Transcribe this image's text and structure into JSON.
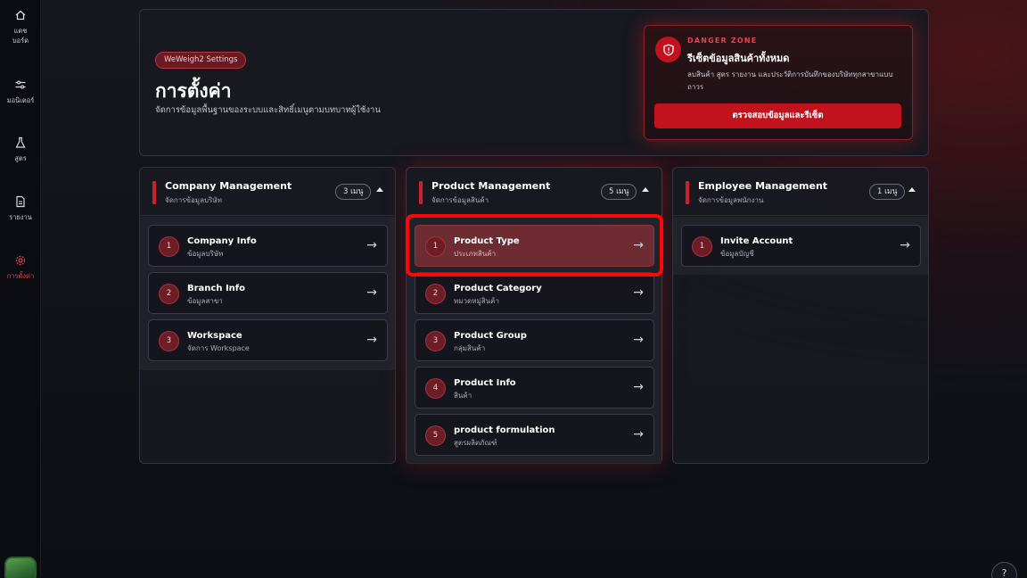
{
  "sidebar": {
    "items": [
      {
        "label": "แดช\nบอร์ด",
        "icon": "home-icon",
        "active": false
      },
      {
        "label": "มอนิเตอร์",
        "icon": "monitor-icon",
        "active": false
      },
      {
        "label": "สูตร",
        "icon": "flask-icon",
        "active": false
      },
      {
        "label": "รายงาน",
        "icon": "document-icon",
        "active": false
      },
      {
        "label": "การตั้งค่า",
        "icon": "gear-icon",
        "active": true
      }
    ]
  },
  "header": {
    "badge": "WeWeigh2 Settings",
    "title": "การตั้งค่า",
    "subtitle": "จัดการข้อมูลพื้นฐานของระบบและสิทธิ์เมนูตามบทบาทผู้ใช้งาน"
  },
  "danger_zone": {
    "label": "DANGER ZONE",
    "title": "รีเซ็ตข้อมูลสินค้าทั้งหมด",
    "description": "ลบสินค้า สูตร รายงาน และประวัติการบันทึกของบริษัททุกสาขาแบบถาวร",
    "button": "ตรวจสอบข้อมูลและรีเซ็ต",
    "accent_color": "#c1121e"
  },
  "columns": [
    {
      "title": "Company Management",
      "subtitle": "จัดการข้อมูลบริษัท",
      "count": "3 เมนู",
      "items": [
        {
          "num": "1",
          "title": "Company Info",
          "subtitle": "ข้อมูลบริษัท"
        },
        {
          "num": "2",
          "title": "Branch Info",
          "subtitle": "ข้อมูลสาขา"
        },
        {
          "num": "3",
          "title": "Workspace",
          "subtitle": "จัดการ Workspace"
        }
      ]
    },
    {
      "title": "Product Management",
      "subtitle": "จัดการข้อมูลสินค้า",
      "count": "5 เมนู",
      "items": [
        {
          "num": "1",
          "title": "Product Type",
          "subtitle": "ประเภทสินค้า"
        },
        {
          "num": "2",
          "title": "Product Category",
          "subtitle": "หมวดหมู่สินค้า"
        },
        {
          "num": "3",
          "title": "Product Group",
          "subtitle": "กลุ่มสินค้า"
        },
        {
          "num": "4",
          "title": "Product Info",
          "subtitle": "สินค้า"
        },
        {
          "num": "5",
          "title": "product formulation",
          "subtitle": "สูตรผลิตภัณฑ์"
        }
      ]
    },
    {
      "title": "Employee Management",
      "subtitle": "จัดการข้อมูลพนักงาน",
      "count": "1 เมนู",
      "items": [
        {
          "num": "1",
          "title": "Invite Account",
          "subtitle": "ข้อมูลบัญชี"
        }
      ]
    }
  ],
  "arrow_glyph": "→",
  "help_glyph": "?"
}
